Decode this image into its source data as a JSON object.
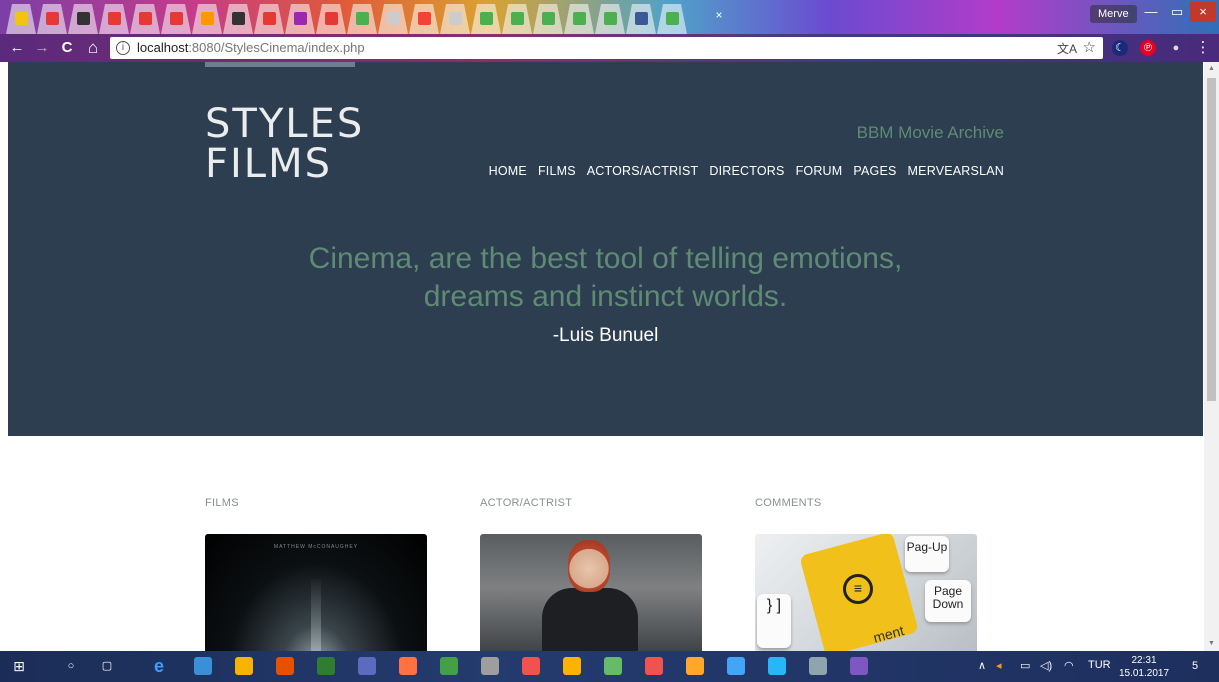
{
  "browser": {
    "profile_name": "Merve",
    "url_host": "localhost",
    "url_path": ":8080/StylesCinema/index.php",
    "tab_favicon_colors": [
      "#f1c40f",
      "#e53935",
      "#333333",
      "#e53935",
      "#e53935",
      "#e53935",
      "#ff9800",
      "#333333",
      "#e53935",
      "#9c27b0",
      "#e53935",
      "#4caf50",
      "#cccccc",
      "#f44336",
      "#cccccc",
      "#4caf50",
      "#4caf50",
      "#4caf50",
      "#4caf50",
      "#4caf50",
      "#3b5998",
      "#4caf50"
    ],
    "icons": {
      "back": "←",
      "forward": "→",
      "reload": "C",
      "home": "⌂",
      "info": "i",
      "translate": "文A",
      "star": "☆",
      "tab_close": "×",
      "ext1": "☾",
      "ext2": "℗",
      "ext3": "●",
      "menu": "⋮",
      "minimize": "—",
      "maximize": "▭",
      "close": "×"
    }
  },
  "site": {
    "logo_line1": "STYLES",
    "logo_line2": "FILMS",
    "tagline": "BBM Movie Archive",
    "nav": [
      "HOME",
      "FILMS",
      "ACTORS/ACTRIST",
      "DIRECTORS",
      "FORUM",
      "PAGES",
      "MERVEARSLAN"
    ],
    "quote": "Cinema, are the best tool of telling emotions, dreams and instinct worlds.",
    "quote_author": "-Luis Bunuel",
    "sections": [
      {
        "title": "FILMS"
      },
      {
        "title": "ACTOR/ACTRIST"
      },
      {
        "title": "COMMENTS"
      }
    ],
    "film_poster_text": "MATTHEW McCONAUGHEY",
    "keyboard_keys": {
      "pg_up": "Pag-Up",
      "pg_down": "Page Down",
      "ment": "ment"
    }
  },
  "taskbar": {
    "language": "TUR",
    "time": "22:31",
    "date": "15.01.2017",
    "notification_count": "5",
    "icons": {
      "start": "⊞",
      "search": "○",
      "taskview": "▢",
      "edge": "e",
      "tray_up": "∧"
    }
  },
  "colors": {
    "hero_bg": "#2c3e50",
    "accent_green": "#5f8a74"
  }
}
